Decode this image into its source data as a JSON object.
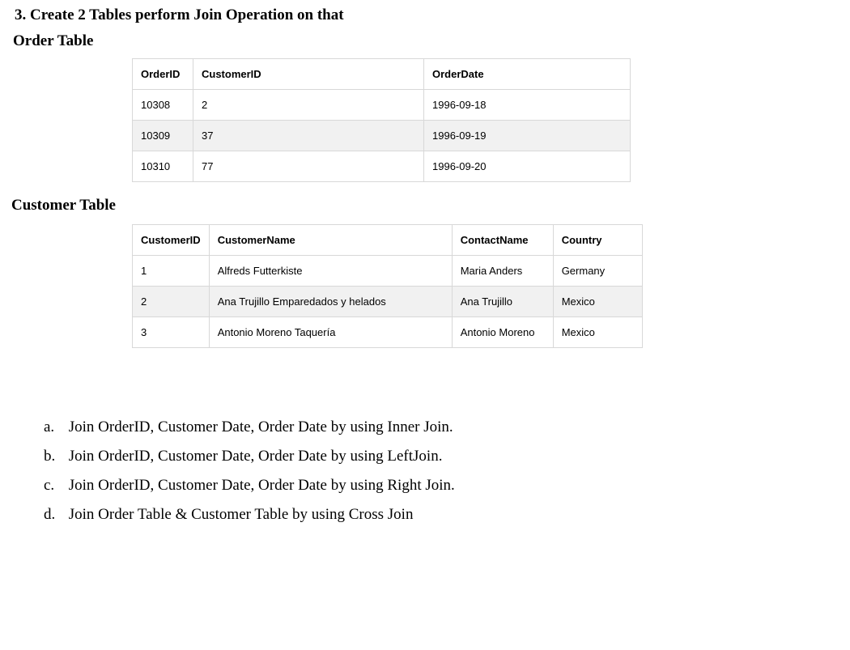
{
  "heading": "3.  Create 2 Tables perform Join Operation on that",
  "orderTableTitle": "Order Table",
  "orderTable": {
    "headers": [
      "OrderID",
      "CustomerID",
      "OrderDate"
    ],
    "rows": [
      {
        "c0": "10308",
        "c1": "2",
        "c2": "1996-09-18"
      },
      {
        "c0": "10309",
        "c1": "37",
        "c2": "1996-09-19"
      },
      {
        "c0": "10310",
        "c1": "77",
        "c2": "1996-09-20"
      }
    ]
  },
  "customerTableTitle": "Customer Table",
  "customerTable": {
    "headers": [
      "CustomerID",
      "CustomerName",
      "ContactName",
      "Country"
    ],
    "rows": [
      {
        "c0": "1",
        "c1": "Alfreds Futterkiste",
        "c2": "Maria Anders",
        "c3": "Germany"
      },
      {
        "c0": "2",
        "c1": "Ana Trujillo Emparedados y helados",
        "c2": "Ana Trujillo",
        "c3": "Mexico"
      },
      {
        "c0": "3",
        "c1": "Antonio Moreno Taquería",
        "c2": "Antonio Moreno",
        "c3": "Mexico"
      }
    ]
  },
  "tasks": [
    {
      "marker": "a.",
      "text": "Join OrderID, Customer Date, Order Date by using Inner Join."
    },
    {
      "marker": "b.",
      "text": "Join OrderID, Customer Date, Order Date by using  LeftJoin."
    },
    {
      "marker": "c.",
      "text": "Join OrderID, Customer Date, Order Date by using Right Join."
    },
    {
      "marker": "d.",
      "text": "Join Order Table & Customer Table by using Cross Join"
    }
  ]
}
